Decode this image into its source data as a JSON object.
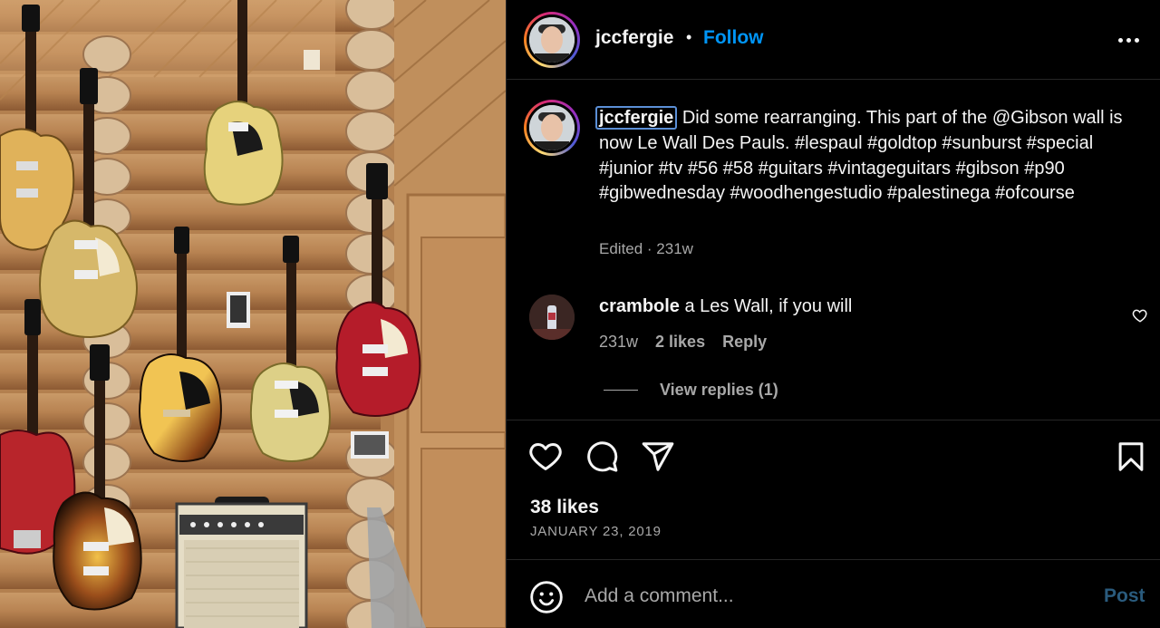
{
  "photo": {
    "alt_subject": "guitar-wall-photo"
  },
  "header": {
    "username": "jccfergie",
    "separator": "•",
    "follow_label": "Follow"
  },
  "caption": {
    "username": "jccfergie",
    "text": "Did some rearranging. This part of the @Gibson wall is now Le Wall Des Pauls. #lespaul #goldtop #sunburst #special #junior #tv #56 #58 #guitars #vintageguitars #gibson #p90 #gibwednesday #woodhengestudio #palestinega #ofcourse",
    "meta": "Edited · 231w"
  },
  "comment": {
    "username": "crambole",
    "text": "a Les Wall, if you will",
    "age": "231w",
    "likes": "2 likes",
    "reply_label": "Reply",
    "view_replies": "View replies (1)"
  },
  "post": {
    "likes": "38 likes",
    "date": "JANUARY 23, 2019"
  },
  "add_comment": {
    "placeholder": "Add a comment...",
    "post_label": "Post"
  },
  "colors": {
    "accent": "#0095f6",
    "background": "#000000",
    "secondary_text": "#a8a8a8",
    "divider": "#262626",
    "post_disabled": "#2a5b7d"
  },
  "icons": [
    "more-options-icon",
    "heart-icon",
    "comment-icon",
    "share-icon",
    "bookmark-icon",
    "emoji-icon",
    "small-heart-icon"
  ]
}
